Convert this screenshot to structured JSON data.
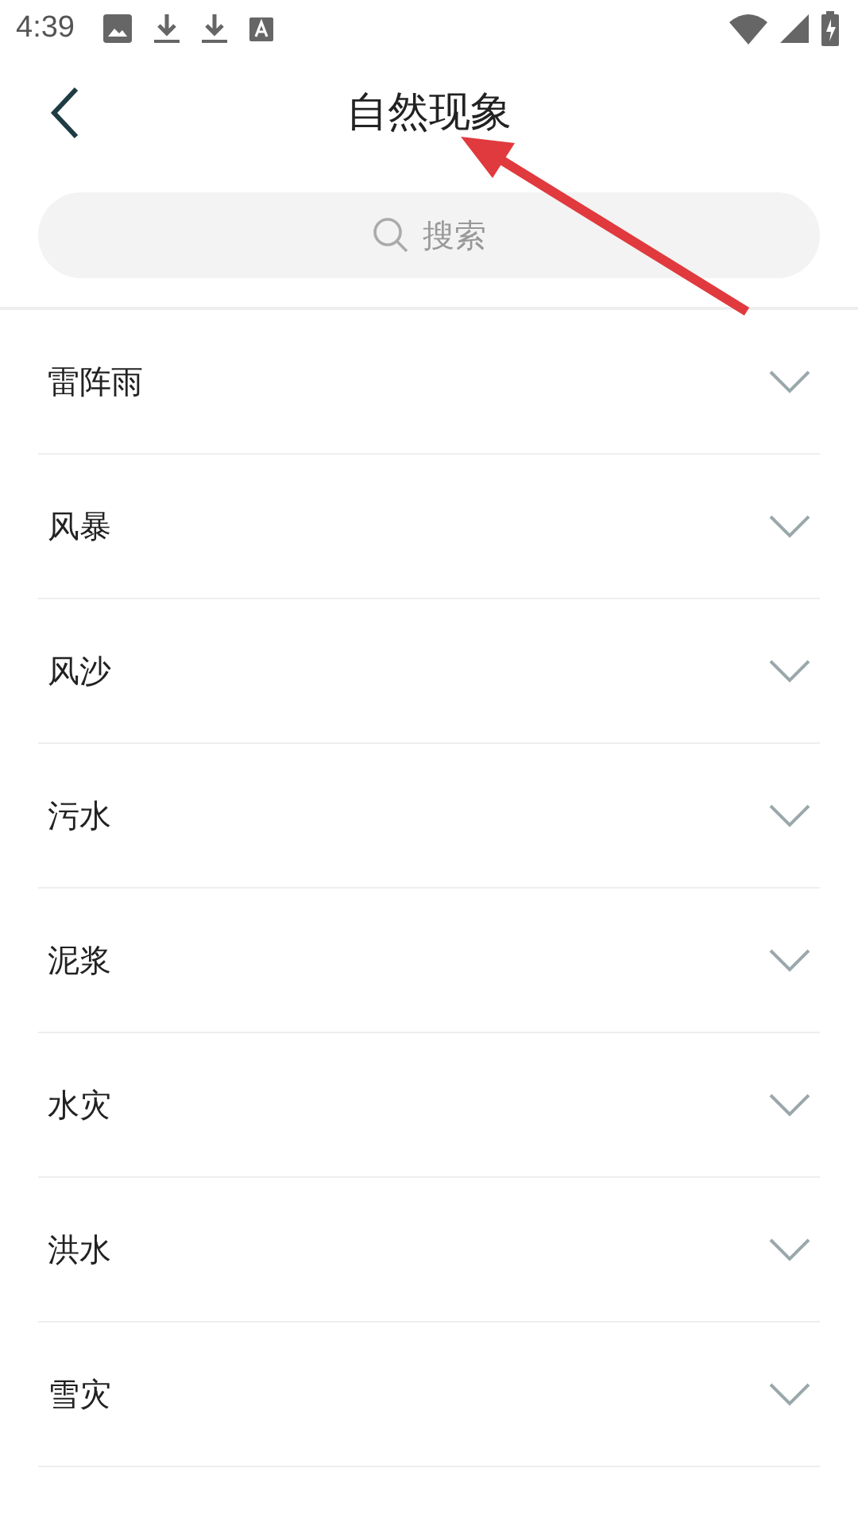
{
  "status_bar": {
    "time": "4:39"
  },
  "header": {
    "title": "自然现象"
  },
  "search": {
    "placeholder": "搜索"
  },
  "items": [
    {
      "label": "雷阵雨",
      "expanded": false
    },
    {
      "label": "风暴",
      "expanded": false
    },
    {
      "label": "风沙",
      "expanded": false
    },
    {
      "label": "污水",
      "expanded": false
    },
    {
      "label": "泥浆",
      "expanded": false
    },
    {
      "label": "水灾",
      "expanded": false
    },
    {
      "label": "洪水",
      "expanded": false
    },
    {
      "label": "雪灾",
      "expanded": false
    }
  ]
}
